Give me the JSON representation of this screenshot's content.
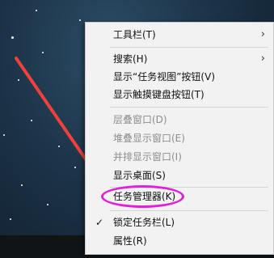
{
  "menu": {
    "items": [
      {
        "label": "工具栏(T)",
        "submenu": true,
        "disabled": false,
        "checked": false
      },
      {
        "label": "搜索(H)",
        "submenu": true,
        "disabled": false,
        "checked": false
      },
      {
        "label": "显示“任务视图”按钮(V)",
        "submenu": false,
        "disabled": false,
        "checked": false
      },
      {
        "label": "显示触摸键盘按钮(T)",
        "submenu": false,
        "disabled": false,
        "checked": false
      },
      {
        "label": "层叠窗口(D)",
        "submenu": false,
        "disabled": true,
        "checked": false
      },
      {
        "label": "堆叠显示窗口(E)",
        "submenu": false,
        "disabled": true,
        "checked": false
      },
      {
        "label": "并排显示窗口(I)",
        "submenu": false,
        "disabled": true,
        "checked": false
      },
      {
        "label": "显示桌面(S)",
        "submenu": false,
        "disabled": false,
        "checked": false
      },
      {
        "label": "任务管理器(K)",
        "submenu": false,
        "disabled": false,
        "checked": false,
        "highlighted": true
      },
      {
        "label": "锁定任务栏(L)",
        "submenu": false,
        "disabled": false,
        "checked": true
      },
      {
        "label": "属性(R)",
        "submenu": false,
        "disabled": false,
        "checked": false
      }
    ],
    "submenu_glyph": "›",
    "check_glyph": "✓"
  },
  "colors": {
    "annotation_arrow": "#f0413b",
    "highlight_ellipse": "#e022d6",
    "menu_background": "#f2f2f2",
    "disabled_text": "#8d8d8d"
  }
}
